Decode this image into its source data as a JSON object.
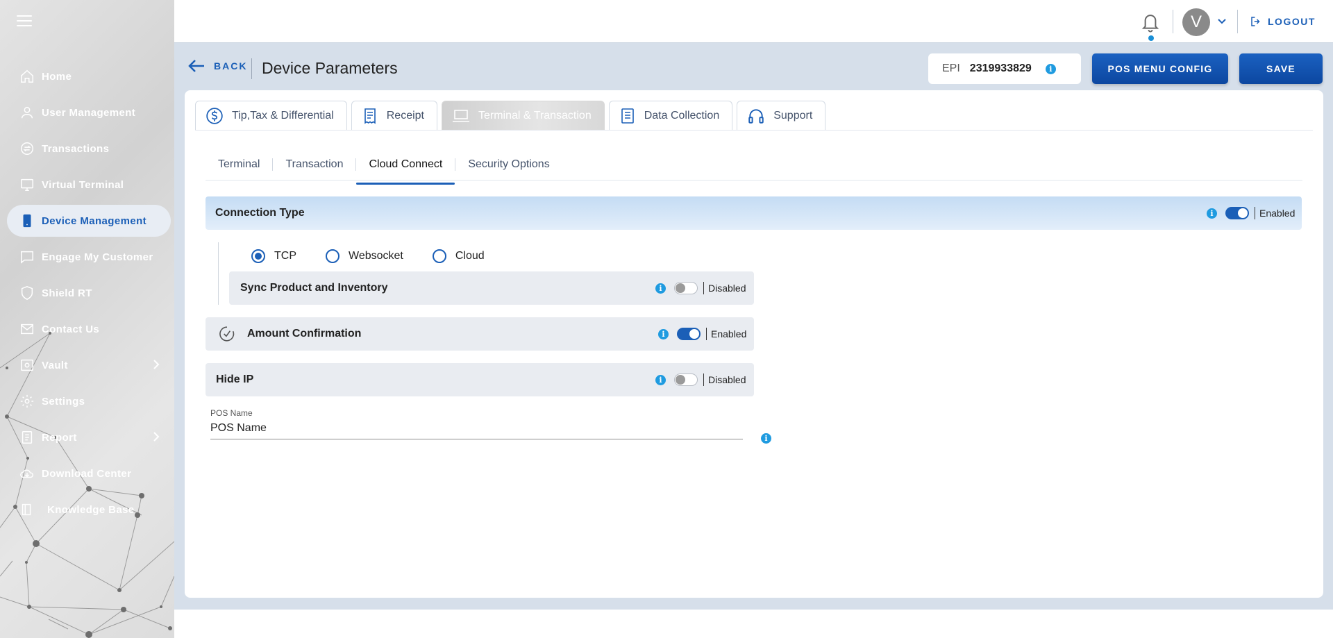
{
  "sidebar": {
    "items": [
      {
        "label": "Home",
        "icon": "home-icon"
      },
      {
        "label": "User Management",
        "icon": "user-icon"
      },
      {
        "label": "Transactions",
        "icon": "transactions-icon"
      },
      {
        "label": "Virtual Terminal",
        "icon": "monitor-icon"
      },
      {
        "label": "Device Management",
        "icon": "device-icon",
        "active": true
      },
      {
        "label": "Engage My Customer",
        "icon": "chat-icon"
      },
      {
        "label": "Shield RT",
        "icon": "shield-icon"
      },
      {
        "label": "Contact Us",
        "icon": "mail-icon"
      },
      {
        "label": "Vault",
        "icon": "vault-icon"
      },
      {
        "label": "Settings",
        "icon": "gear-icon"
      },
      {
        "label": "Report",
        "icon": "report-icon"
      },
      {
        "label": "Download Center",
        "icon": "cloud-download-icon"
      },
      {
        "label": "Knowledge Base",
        "icon": "book-icon"
      }
    ]
  },
  "header": {
    "avatar_letter": "V",
    "logout_label": "LOGOUT"
  },
  "page": {
    "back_label": "BACK",
    "title": "Device Parameters",
    "epi_label": "EPI",
    "epi_value": "2319933829",
    "pos_menu_config_label": "POS MENU CONFIG",
    "save_label": "SAVE"
  },
  "main_tabs": [
    {
      "label": "Tip,Tax & Differential",
      "icon": "dollar-icon"
    },
    {
      "label": "Receipt",
      "icon": "receipt-icon"
    },
    {
      "label": "Terminal & Transaction",
      "icon": "terminal-icon",
      "active": true
    },
    {
      "label": "Data Collection",
      "icon": "document-icon"
    },
    {
      "label": "Support",
      "icon": "headset-icon"
    }
  ],
  "sub_tabs": [
    {
      "label": "Terminal"
    },
    {
      "label": "Transaction"
    },
    {
      "label": "Cloud Connect",
      "active": true
    },
    {
      "label": "Security Options"
    }
  ],
  "cloud_connect": {
    "connection_type": {
      "label": "Connection Type",
      "state": "Enabled",
      "on": true
    },
    "radio_options": [
      {
        "label": "TCP",
        "checked": true
      },
      {
        "label": "Websocket",
        "checked": false
      },
      {
        "label": "Cloud",
        "checked": false
      }
    ],
    "sync_product": {
      "label": "Sync Product and Inventory",
      "state": "Disabled",
      "on": false
    },
    "amount_confirmation": {
      "label": "Amount Confirmation",
      "state": "Enabled",
      "on": true
    },
    "hide_ip": {
      "label": "Hide IP",
      "state": "Disabled",
      "on": false
    },
    "pos_name": {
      "label": "POS Name",
      "value": "POS Name"
    }
  },
  "colors": {
    "primary": "#1b5fb7",
    "info": "#1f9be0",
    "background": "#d6dfea"
  }
}
